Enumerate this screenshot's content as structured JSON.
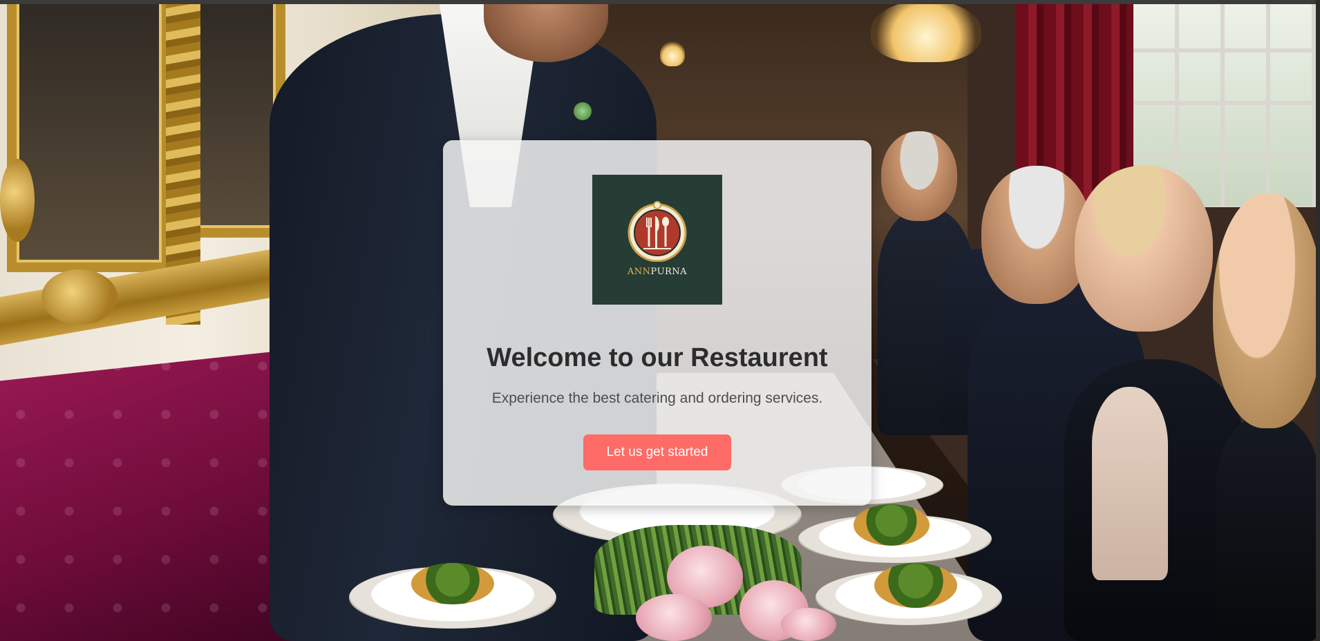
{
  "brand": {
    "logo_accent_text": "ANN",
    "logo_rest_text": "PURNA",
    "logo_background_color": "#263d36",
    "logo_accent_color": "#e6b64a",
    "logo_plate_color": "#b0392b"
  },
  "hero": {
    "title": "Welcome to our Restaurent",
    "subtitle": "Experience the best catering and ordering services.",
    "cta_label": "Let us get started",
    "cta_color": "#ff6b66"
  },
  "icons": {
    "logo": "cutlery-on-plate-emblem"
  }
}
